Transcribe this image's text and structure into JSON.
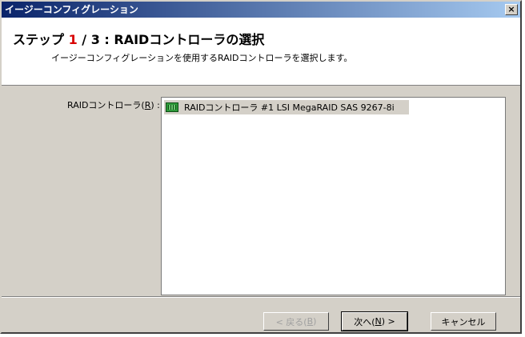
{
  "window": {
    "title": "イージーコンフィグレーション",
    "close_glyph": "×"
  },
  "header": {
    "step_prefix": "ステップ ",
    "step_current": "1",
    "step_sep": " / ",
    "step_total": "3",
    "step_title_rest": " : RAIDコントローラの選択",
    "description": "イージーコンフィグレーションを使用するRAIDコントローラを選択します。"
  },
  "form": {
    "label_prefix": "RAIDコントローラ(",
    "label_accel": "R",
    "label_suffix": ") :",
    "list_items": [
      {
        "icon": "raid-controller-icon",
        "text": "RAIDコントローラ #1 LSI MegaRAID SAS 9267-8i"
      }
    ]
  },
  "buttons": {
    "back_prefix": "< 戻る(",
    "back_accel": "B",
    "back_suffix": ")",
    "next_prefix": "次へ(",
    "next_accel": "N",
    "next_suffix": ") >",
    "cancel": "キャンセル"
  }
}
